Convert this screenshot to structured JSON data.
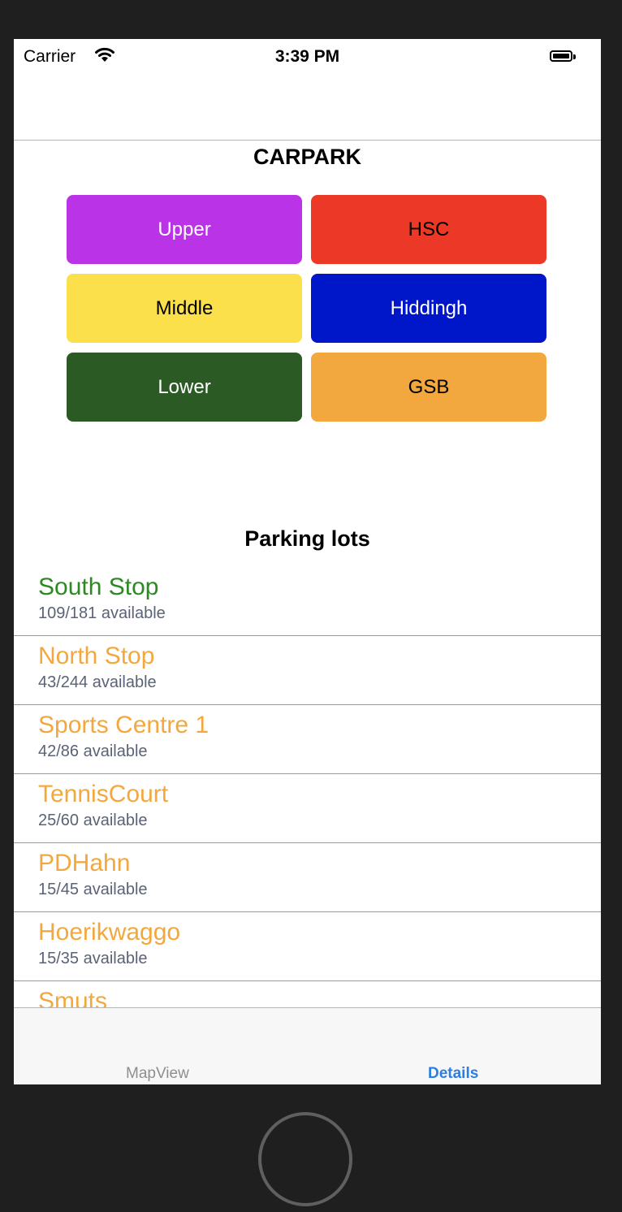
{
  "status_bar": {
    "carrier": "Carrier",
    "time": "3:39 PM"
  },
  "header": {
    "title": "CARPARK"
  },
  "buttons": [
    {
      "label": "Upper",
      "bg": "#bb33e6",
      "fg": "#ffffff"
    },
    {
      "label": "HSC",
      "bg": "#ec3927",
      "fg": "#000000"
    },
    {
      "label": "Middle",
      "bg": "#fbe04b",
      "fg": "#000000"
    },
    {
      "label": "Hiddingh",
      "bg": "#0016c9",
      "fg": "#ffffff"
    },
    {
      "label": "Lower",
      "bg": "#2c5a25",
      "fg": "#ffffff"
    },
    {
      "label": "GSB",
      "bg": "#f2a83e",
      "fg": "#000000"
    }
  ],
  "parking": {
    "title": "Parking lots",
    "lots": [
      {
        "name": "South Stop",
        "availability": "109/181 available",
        "color": "#2b8a20"
      },
      {
        "name": "North Stop",
        "availability": "43/244 available",
        "color": "#f2a83e"
      },
      {
        "name": "Sports Centre 1",
        "availability": "42/86 available",
        "color": "#f2a83e"
      },
      {
        "name": "TennisCourt",
        "availability": "25/60 available",
        "color": "#f2a83e"
      },
      {
        "name": "PDHahn",
        "availability": "15/45 available",
        "color": "#f2a83e"
      },
      {
        "name": "Hoerikwaggo",
        "availability": "15/35 available",
        "color": "#f2a83e"
      },
      {
        "name": "Smuts",
        "availability": "",
        "color": "#f2a83e"
      }
    ]
  },
  "tabs": {
    "map": "MapView",
    "details": "Details"
  }
}
